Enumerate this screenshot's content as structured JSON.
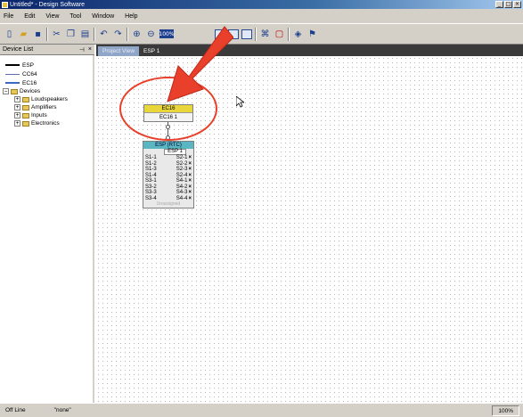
{
  "window": {
    "title": "Untitled* - Design Software",
    "controls": [
      "_",
      "□",
      "×"
    ]
  },
  "menu": [
    "File",
    "Edit",
    "View",
    "Tool",
    "Window",
    "Help"
  ],
  "toolbar": {
    "icons": [
      "new-file-icon",
      "open-folder-icon",
      "save-icon",
      "cut-icon",
      "copy-icon",
      "paste-icon",
      "undo-icon",
      "redo-icon",
      "zoom-in-icon",
      "zoom-out-icon",
      "zoom-fit-icon",
      "arrow-tool-icon",
      "grid-icon",
      "grid-alt-icon",
      "grid-view-icon",
      "connect-icon",
      "record-icon",
      "speaker-icon",
      "flag-icon"
    ],
    "zoom_label": "100%"
  },
  "device_list": {
    "title": "Device List",
    "pin": "⊣",
    "close": "×",
    "cables": [
      "ESP",
      "CC64",
      "EC16"
    ],
    "tree": {
      "root": "Devices",
      "children": [
        "Loudspeakers",
        "Amplifiers",
        "Inputs",
        "Electronics"
      ]
    }
  },
  "tabs": [
    "Project View",
    "ESP 1"
  ],
  "canvas": {
    "ec16": {
      "header": "EC16",
      "body": "EC16 1"
    },
    "esp": {
      "header": "ESP (RTC)",
      "sub": "ESP 1",
      "left_ports": [
        "S1-1",
        "S1-2",
        "S1-3",
        "S1-4",
        "S3-1",
        "S3-2",
        "S3-3",
        "S3-4"
      ],
      "right_ports": [
        "S2-1",
        "S2-2",
        "S2-3",
        "S2-4",
        "S4-1",
        "S4-2",
        "S4-3",
        "S4-4"
      ],
      "port_mark": "×",
      "footer": "Unassigned"
    },
    "highlight_color": "#e8402a"
  },
  "status": {
    "mode": "Off Line",
    "selection": "\"none\"",
    "zoom": "100%"
  }
}
